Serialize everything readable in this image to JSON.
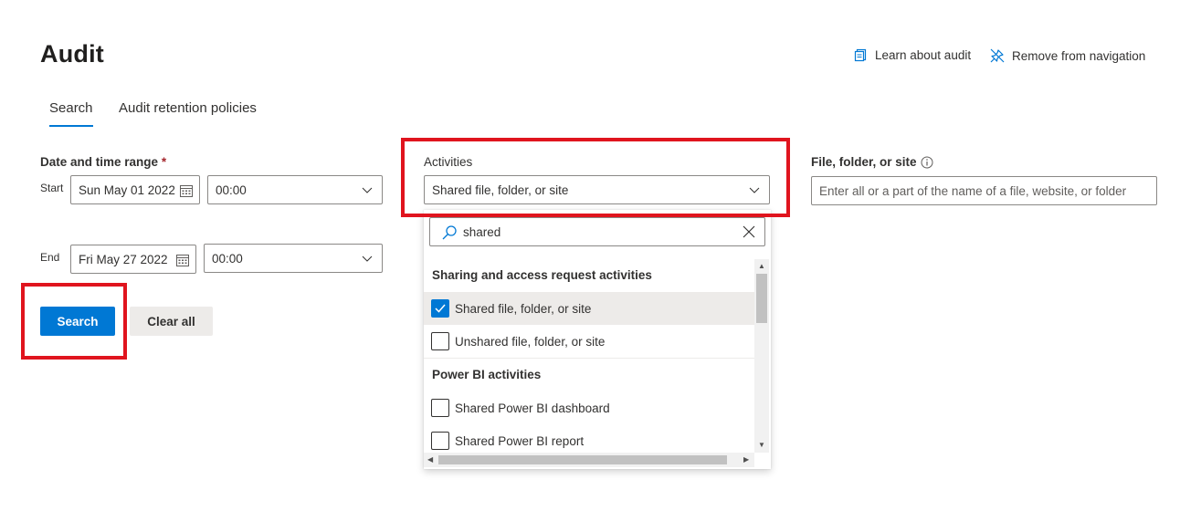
{
  "page": {
    "title": "Audit"
  },
  "header_links": {
    "learn": "Learn about audit",
    "remove": "Remove from navigation"
  },
  "tabs": [
    {
      "label": "Search",
      "active": true
    },
    {
      "label": "Audit retention policies",
      "active": false
    }
  ],
  "date_range": {
    "label": "Date and time range",
    "required_mark": "*",
    "start_label": "Start",
    "start_date": "Sun May 01 2022",
    "start_time": "00:00",
    "end_label": "End",
    "end_date": "Fri May 27 2022",
    "end_time": "00:00"
  },
  "activities": {
    "label": "Activities",
    "selected_value": "Shared file, folder, or site",
    "search_text": "shared",
    "groups": [
      {
        "header": "Sharing and access request activities",
        "options": [
          {
            "label": "Shared file, folder, or site",
            "checked": true
          },
          {
            "label": "Unshared file, folder, or site",
            "checked": false
          }
        ]
      },
      {
        "header": "Power BI activities",
        "options": [
          {
            "label": "Shared Power BI dashboard",
            "checked": false
          },
          {
            "label": "Shared Power BI report",
            "checked": false
          }
        ]
      }
    ]
  },
  "file_field": {
    "label": "File, folder, or site",
    "placeholder": "Enter all or a part of the name of a file, website, or folder"
  },
  "buttons": {
    "search": "Search",
    "clear": "Clear all"
  },
  "colors": {
    "accent": "#0078d4",
    "highlight": "#e0141e"
  }
}
